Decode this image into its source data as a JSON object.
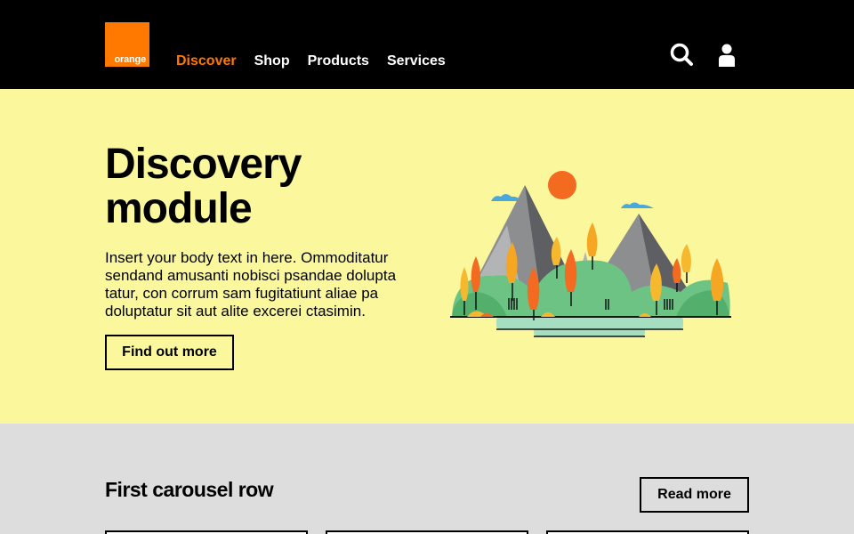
{
  "header": {
    "logo_text": "orange",
    "nav": [
      {
        "label": "Discover",
        "active": true
      },
      {
        "label": "Shop",
        "active": false
      },
      {
        "label": "Products",
        "active": false
      },
      {
        "label": "Services",
        "active": false
      }
    ],
    "icons": [
      "search-icon",
      "account-icon"
    ]
  },
  "hero": {
    "title": "Discovery module",
    "body": "Insert your body text in here. Ommoditatur sendand amusanti nobisci psandae dolupta tatur, con corrum sam fugitatiunt aliae pa doluptatur sit aut alite excerei ctasimin.",
    "button_label": "Find out more"
  },
  "carousel": {
    "title": "First carousel row",
    "button_label": "Read more"
  },
  "colors": {
    "brand": "#ff7900",
    "header_bg": "#000000",
    "hero_bg": "#fbf79c",
    "carousel_bg": "#dddddd"
  }
}
